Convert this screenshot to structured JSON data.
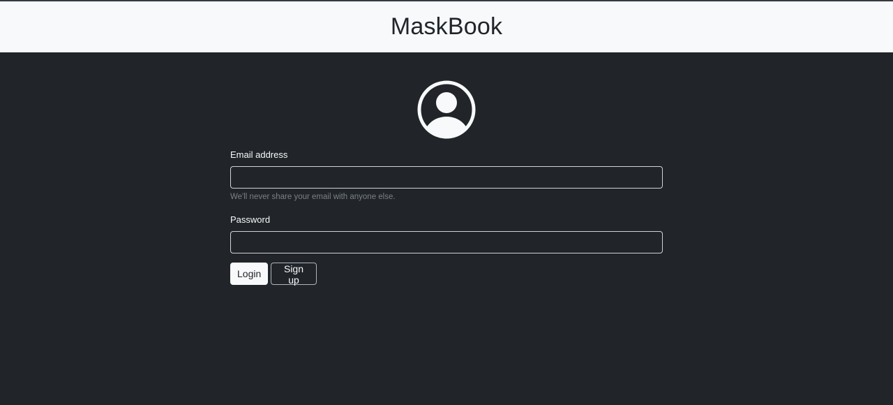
{
  "header": {
    "brand": "MaskBook"
  },
  "avatar": {
    "icon": "person-circle-icon"
  },
  "form": {
    "email": {
      "label": "Email address",
      "value": "",
      "placeholder": "",
      "help": "We'll never share your email with anyone else."
    },
    "password": {
      "label": "Password",
      "value": "",
      "placeholder": ""
    },
    "login_label": "Login",
    "signup_label": "Sign up"
  },
  "colors": {
    "page_background": "#212529",
    "header_background": "#f8f9fa",
    "text_light": "#f8f9fa",
    "help_text": "#7a8087"
  }
}
